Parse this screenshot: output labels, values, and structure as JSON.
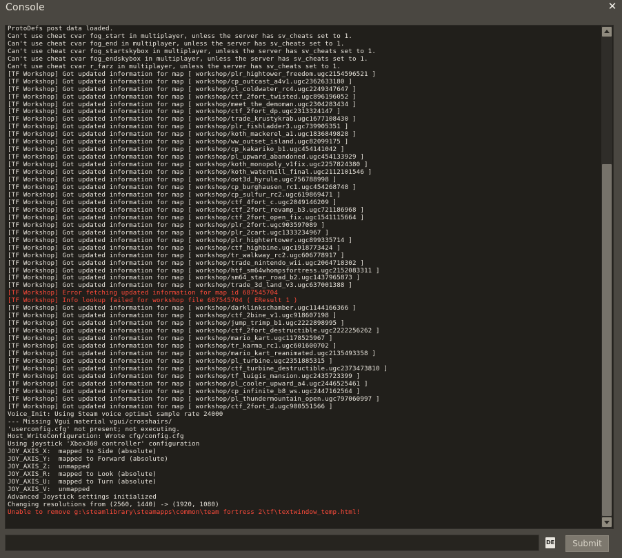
{
  "window": {
    "title": "Console",
    "close_label": "✕"
  },
  "colors": {
    "window_bg": "#4a4741",
    "console_bg": "#211f1b",
    "text": "#e8e4dc",
    "error_text": "#ff4b3b",
    "scrollbar_thumb": "#76726a",
    "submit_bg": "#7d786e"
  },
  "icons": {
    "close": "close-icon",
    "scroll_up": "chevron-up-icon",
    "scroll_down": "chevron-down-icon",
    "ime": "ime-indicator-icon"
  },
  "scroll_position_fraction": 0.26,
  "console": {
    "lines": [
      {
        "text": "ProtoDefs post data loaded.",
        "error": false
      },
      {
        "text": "Can't use cheat cvar fog_start in multiplayer, unless the server has sv_cheats set to 1.",
        "error": false
      },
      {
        "text": "Can't use cheat cvar fog_end in multiplayer, unless the server has sv_cheats set to 1.",
        "error": false
      },
      {
        "text": "Can't use cheat cvar fog_startskybox in multiplayer, unless the server has sv_cheats set to 1.",
        "error": false
      },
      {
        "text": "Can't use cheat cvar fog_endskybox in multiplayer, unless the server has sv_cheats set to 1.",
        "error": false
      },
      {
        "text": "Can't use cheat cvar r_farz in multiplayer, unless the server has sv_cheats set to 1.",
        "error": false
      },
      {
        "text": "[TF Workshop] Got updated information for map [ workshop/plr_hightower_freedom.ugc2154596521 ]",
        "error": false
      },
      {
        "text": "[TF Workshop] Got updated information for map [ workshop/cp_outcast_a4v1.ugc2362633180 ]",
        "error": false
      },
      {
        "text": "[TF Workshop] Got updated information for map [ workshop/pl_coldwater_rc4.ugc2249347647 ]",
        "error": false
      },
      {
        "text": "[TF Workshop] Got updated information for map [ workshop/ctf_2fort_twisted.ugc896196052 ]",
        "error": false
      },
      {
        "text": "[TF Workshop] Got updated information for map [ workshop/meet_the_demoman.ugc2304283434 ]",
        "error": false
      },
      {
        "text": "[TF Workshop] Got updated information for map [ workshop/ctf_2fort_dp.ugc2313324147 ]",
        "error": false
      },
      {
        "text": "[TF Workshop] Got updated information for map [ workshop/trade_krustykrab.ugc1677108430 ]",
        "error": false
      },
      {
        "text": "[TF Workshop] Got updated information for map [ workshop/plr_fishladder3.ugc739905351 ]",
        "error": false
      },
      {
        "text": "[TF Workshop] Got updated information for map [ workshop/koth_mackerel_a1.ugc1836849828 ]",
        "error": false
      },
      {
        "text": "[TF Workshop] Got updated information for map [ workshop/ww_outset_island.ugc82099175 ]",
        "error": false
      },
      {
        "text": "[TF Workshop] Got updated information for map [ workshop/cp_kakariko_b1.ugc454141042 ]",
        "error": false
      },
      {
        "text": "[TF Workshop] Got updated information for map [ workshop/pl_upward_abandoned.ugc454133929 ]",
        "error": false
      },
      {
        "text": "[TF Workshop] Got updated information for map [ workshop/koth_monopoly_v1fix.ugc2257824380 ]",
        "error": false
      },
      {
        "text": "[TF Workshop] Got updated information for map [ workshop/koth_watermill_final.ugc2112101546 ]",
        "error": false
      },
      {
        "text": "[TF Workshop] Got updated information for map [ workshop/oot3d_hyrule.ugc756788998 ]",
        "error": false
      },
      {
        "text": "[TF Workshop] Got updated information for map [ workshop/cp_burghausen_rc1.ugc454268748 ]",
        "error": false
      },
      {
        "text": "[TF Workshop] Got updated information for map [ workshop/cp_sulfur_rc2.ugc619869471 ]",
        "error": false
      },
      {
        "text": "[TF Workshop] Got updated information for map [ workshop/ctf_4fort_c.ugc2049146209 ]",
        "error": false
      },
      {
        "text": "[TF Workshop] Got updated information for map [ workshop/ctf_2fort_revamp_b3.ugc721186968 ]",
        "error": false
      },
      {
        "text": "[TF Workshop] Got updated information for map [ workshop/ctf_2fort_open_fix.ugc1541115664 ]",
        "error": false
      },
      {
        "text": "[TF Workshop] Got updated information for map [ workshop/plr_2fort.ugc903597089 ]",
        "error": false
      },
      {
        "text": "[TF Workshop] Got updated information for map [ workshop/plr_2cart.ugc1333234967 ]",
        "error": false
      },
      {
        "text": "[TF Workshop] Got updated information for map [ workshop/plr_hightertower.ugc899335714 ]",
        "error": false
      },
      {
        "text": "[TF Workshop] Got updated information for map [ workshop/ctf_highbine.ugc1918773424 ]",
        "error": false
      },
      {
        "text": "[TF Workshop] Got updated information for map [ workshop/tr_walkway_rc2.ugc606778917 ]",
        "error": false
      },
      {
        "text": "[TF Workshop] Got updated information for map [ workshop/trade_nintendo_wii.ugc2064718302 ]",
        "error": false
      },
      {
        "text": "[TF Workshop] Got updated information for map [ workshop/htf_sm64whompsfortress.ugc2152083311 ]",
        "error": false
      },
      {
        "text": "[TF Workshop] Got updated information for map [ workshop/sm64_star_road_b2.ugc1437965873 ]",
        "error": false
      },
      {
        "text": "[TF Workshop] Got updated information for map [ workshop/trade_3d_land_v3.ugc637001388 ]",
        "error": false
      },
      {
        "text": "[TF Workshop] Error fetching updated information for map id 687545704",
        "error": true
      },
      {
        "text": "[TF Workshop] Info lookup failed for workshop file 687545704 ( EResult 1 )",
        "error": true
      },
      {
        "text": "[TF Workshop] Got updated information for map [ workshop/darklinkschamber.ugc1144166366 ]",
        "error": false
      },
      {
        "text": "[TF Workshop] Got updated information for map [ workshop/ctf_2bine_v1.ugc918607198 ]",
        "error": false
      },
      {
        "text": "[TF Workshop] Got updated information for map [ workshop/jump_trimp_b1.ugc2222898995 ]",
        "error": false
      },
      {
        "text": "[TF Workshop] Got updated information for map [ workshop/ctf_2fort_destructible.ugc2222256262 ]",
        "error": false
      },
      {
        "text": "[TF Workshop] Got updated information for map [ workshop/mario_kart.ugc1178525967 ]",
        "error": false
      },
      {
        "text": "[TF Workshop] Got updated information for map [ workshop/tr_karma_rc1.ugc601600702 ]",
        "error": false
      },
      {
        "text": "[TF Workshop] Got updated information for map [ workshop/mario_kart_reanimated.ugc2135493358 ]",
        "error": false
      },
      {
        "text": "[TF Workshop] Got updated information for map [ workshop/pl_turbine.ugc2351885315 ]",
        "error": false
      },
      {
        "text": "[TF Workshop] Got updated information for map [ workshop/ctf_turbine_destructible.ugc2373473810 ]",
        "error": false
      },
      {
        "text": "[TF Workshop] Got updated information for map [ workshop/tf_luigis_mansion.ugc2435723399 ]",
        "error": false
      },
      {
        "text": "[TF Workshop] Got updated information for map [ workshop/pl_cooler_upward_a4.ugc2446525461 ]",
        "error": false
      },
      {
        "text": "[TF Workshop] Got updated information for map [ workshop/cp_infinite_b8_ws.ugc2447162564 ]",
        "error": false
      },
      {
        "text": "[TF Workshop] Got updated information for map [ workshop/pl_thundermountain_open.ugc797060997 ]",
        "error": false
      },
      {
        "text": "[TF Workshop] Got updated information for map [ workshop/ctf_2fort_d.ugc900551566 ]",
        "error": false
      },
      {
        "text": "Voice_Init: Using Steam voice optimal sample rate 24000",
        "error": false
      },
      {
        "text": "--- Missing Vgui material vgui/crosshairs/",
        "error": false
      },
      {
        "text": "'userconfig.cfg' not present; not executing.",
        "error": false
      },
      {
        "text": "Host_WriteConfiguration: Wrote cfg/config.cfg",
        "error": false
      },
      {
        "text": "Using joystick 'Xbox360 controller' configuration",
        "error": false
      },
      {
        "text": "JOY_AXIS_X:  mapped to Side (absolute)",
        "error": false
      },
      {
        "text": "JOY_AXIS_Y:  mapped to Forward (absolute)",
        "error": false
      },
      {
        "text": "JOY_AXIS_Z:  unmapped",
        "error": false
      },
      {
        "text": "JOY_AXIS_R:  mapped to Look (absolute)",
        "error": false
      },
      {
        "text": "JOY_AXIS_U:  mapped to Turn (absolute)",
        "error": false
      },
      {
        "text": "JOY_AXIS_V:  unmapped",
        "error": false
      },
      {
        "text": "Advanced Joystick settings initialized",
        "error": false
      },
      {
        "text": "Changing resolutions from (2560, 1440) -> (1920, 1080)",
        "error": false
      },
      {
        "text": "Unable to remove g:\\steamlibrary\\steamapps\\common\\team fortress 2\\tf\\textwindow_temp.html!",
        "error": true
      }
    ]
  },
  "input": {
    "value": "",
    "placeholder": "",
    "ime_label": "DE"
  },
  "submit_label": "Submit"
}
